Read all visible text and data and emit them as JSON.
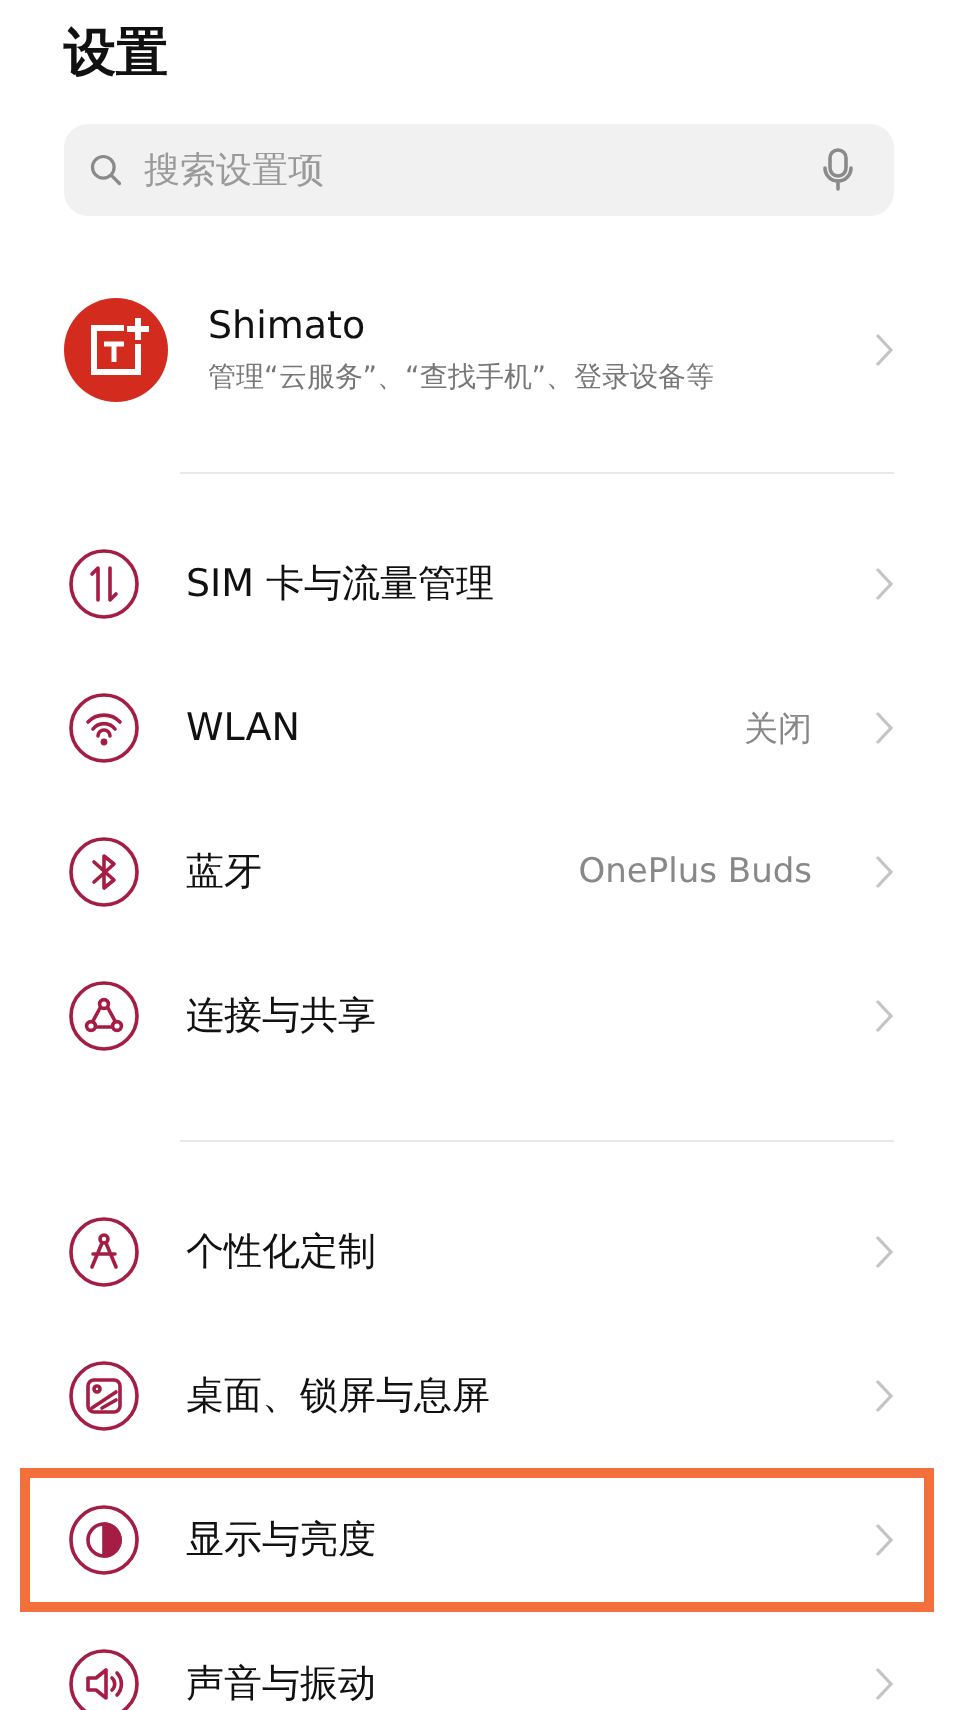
{
  "title": "设置",
  "search": {
    "placeholder": "搜索设置项"
  },
  "account": {
    "name": "Shimato",
    "subtitle": "管理“云服务”、“查找手机”、登录设备等"
  },
  "groups": [
    {
      "items": [
        {
          "kind": "sim",
          "label": "SIM 卡与流量管理",
          "highlighted": false
        },
        {
          "kind": "wifi",
          "label": "WLAN",
          "value": "关闭",
          "highlighted": false
        },
        {
          "kind": "bluetooth",
          "label": "蓝牙",
          "value": "OnePlus Buds",
          "highlighted": false
        },
        {
          "kind": "share",
          "label": "连接与共享",
          "highlighted": false
        }
      ]
    },
    {
      "items": [
        {
          "kind": "compass",
          "label": "个性化定制",
          "highlighted": false
        },
        {
          "kind": "wallpaper",
          "label": "桌面、锁屏与息屏",
          "highlighted": false
        },
        {
          "kind": "display",
          "label": "显示与亮度",
          "highlighted": true
        },
        {
          "kind": "sound",
          "label": "声音与振动",
          "highlighted": false
        }
      ]
    }
  ]
}
